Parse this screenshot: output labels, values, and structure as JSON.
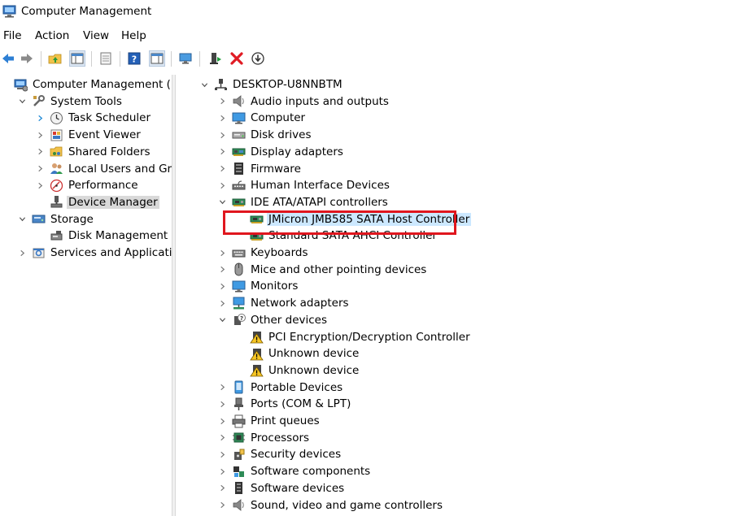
{
  "window": {
    "title": "Computer Management",
    "icon": "computer-management-icon"
  },
  "menu": [
    "File",
    "Action",
    "View",
    "Help"
  ],
  "toolbar": {
    "buttons": [
      "back-arrow-icon",
      "forward-arrow-icon",
      "up-folder-icon",
      "show-hide-tree-icon",
      "properties-icon",
      "help-icon",
      "action-pane-icon",
      "monitor-icon",
      "update-driver-icon",
      "uninstall-icon",
      "download-icon"
    ],
    "colors": {
      "arrow": "#2d7fd4",
      "uninstall": "#e01b24",
      "update": "#1f9d3a"
    }
  },
  "left_tree": [
    {
      "label": "Computer Management (Local",
      "icon": "computer-management-icon",
      "indent": 0,
      "chevron": "none"
    },
    {
      "label": "System Tools",
      "icon": "tools-icon",
      "indent": 1,
      "chevron": "down"
    },
    {
      "label": "Task Scheduler",
      "icon": "clock-icon",
      "indent": 2,
      "chevron": "right-blue"
    },
    {
      "label": "Event Viewer",
      "icon": "event-viewer-icon",
      "indent": 2,
      "chevron": "right"
    },
    {
      "label": "Shared Folders",
      "icon": "shared-folder-icon",
      "indent": 2,
      "chevron": "right"
    },
    {
      "label": "Local Users and Groups",
      "icon": "users-icon",
      "indent": 2,
      "chevron": "right"
    },
    {
      "label": "Performance",
      "icon": "performance-icon",
      "indent": 2,
      "chevron": "right"
    },
    {
      "label": "Device Manager",
      "icon": "device-manager-icon",
      "indent": 2,
      "chevron": "none",
      "selected": true
    },
    {
      "label": "Storage",
      "icon": "storage-icon",
      "indent": 1,
      "chevron": "down"
    },
    {
      "label": "Disk Management",
      "icon": "disk-management-icon",
      "indent": 2,
      "chevron": "none"
    },
    {
      "label": "Services and Applications",
      "icon": "services-icon",
      "indent": 1,
      "chevron": "right"
    }
  ],
  "device_tree": [
    {
      "label": "DESKTOP-U8NNBTM",
      "icon": "computer-tree-icon",
      "indent": 0,
      "chevron": "down"
    },
    {
      "label": "Audio inputs and outputs",
      "icon": "speaker-icon",
      "indent": 1,
      "chevron": "right"
    },
    {
      "label": "Computer",
      "icon": "monitor-icon",
      "indent": 1,
      "chevron": "right"
    },
    {
      "label": "Disk drives",
      "icon": "disk-drive-icon",
      "indent": 1,
      "chevron": "right"
    },
    {
      "label": "Display adapters",
      "icon": "display-adapter-icon",
      "indent": 1,
      "chevron": "right"
    },
    {
      "label": "Firmware",
      "icon": "firmware-icon",
      "indent": 1,
      "chevron": "right"
    },
    {
      "label": "Human Interface Devices",
      "icon": "hid-icon",
      "indent": 1,
      "chevron": "right"
    },
    {
      "label": "IDE ATA/ATAPI controllers",
      "icon": "controller-icon",
      "indent": 1,
      "chevron": "down"
    },
    {
      "label": "JMicron JMB585 SATA Host Controller",
      "icon": "controller-icon",
      "indent": 2,
      "chevron": "none",
      "highlight": true
    },
    {
      "label": "Standard SATA AHCI Controller",
      "icon": "controller-icon",
      "indent": 2,
      "chevron": "none"
    },
    {
      "label": "Keyboards",
      "icon": "keyboard-icon",
      "indent": 1,
      "chevron": "right"
    },
    {
      "label": "Mice and other pointing devices",
      "icon": "mouse-icon",
      "indent": 1,
      "chevron": "right"
    },
    {
      "label": "Monitors",
      "icon": "monitor-icon",
      "indent": 1,
      "chevron": "right"
    },
    {
      "label": "Network adapters",
      "icon": "network-icon",
      "indent": 1,
      "chevron": "right"
    },
    {
      "label": "Other devices",
      "icon": "unknown-device-icon",
      "indent": 1,
      "chevron": "down"
    },
    {
      "label": "PCI Encryption/Decryption Controller",
      "icon": "warning-device-icon",
      "indent": 2,
      "chevron": "none"
    },
    {
      "label": "Unknown device",
      "icon": "warning-device-icon",
      "indent": 2,
      "chevron": "none"
    },
    {
      "label": "Unknown device",
      "icon": "warning-device-icon",
      "indent": 2,
      "chevron": "none"
    },
    {
      "label": "Portable Devices",
      "icon": "portable-device-icon",
      "indent": 1,
      "chevron": "right"
    },
    {
      "label": "Ports (COM & LPT)",
      "icon": "port-icon",
      "indent": 1,
      "chevron": "right"
    },
    {
      "label": "Print queues",
      "icon": "printer-icon",
      "indent": 1,
      "chevron": "right"
    },
    {
      "label": "Processors",
      "icon": "processor-icon",
      "indent": 1,
      "chevron": "right"
    },
    {
      "label": "Security devices",
      "icon": "security-device-icon",
      "indent": 1,
      "chevron": "right"
    },
    {
      "label": "Software components",
      "icon": "software-component-icon",
      "indent": 1,
      "chevron": "right"
    },
    {
      "label": "Software devices",
      "icon": "software-device-icon",
      "indent": 1,
      "chevron": "right"
    },
    {
      "label": "Sound, video and game controllers",
      "icon": "speaker-icon",
      "indent": 1,
      "chevron": "right"
    }
  ],
  "annotation": {
    "color": "#e0161e"
  }
}
